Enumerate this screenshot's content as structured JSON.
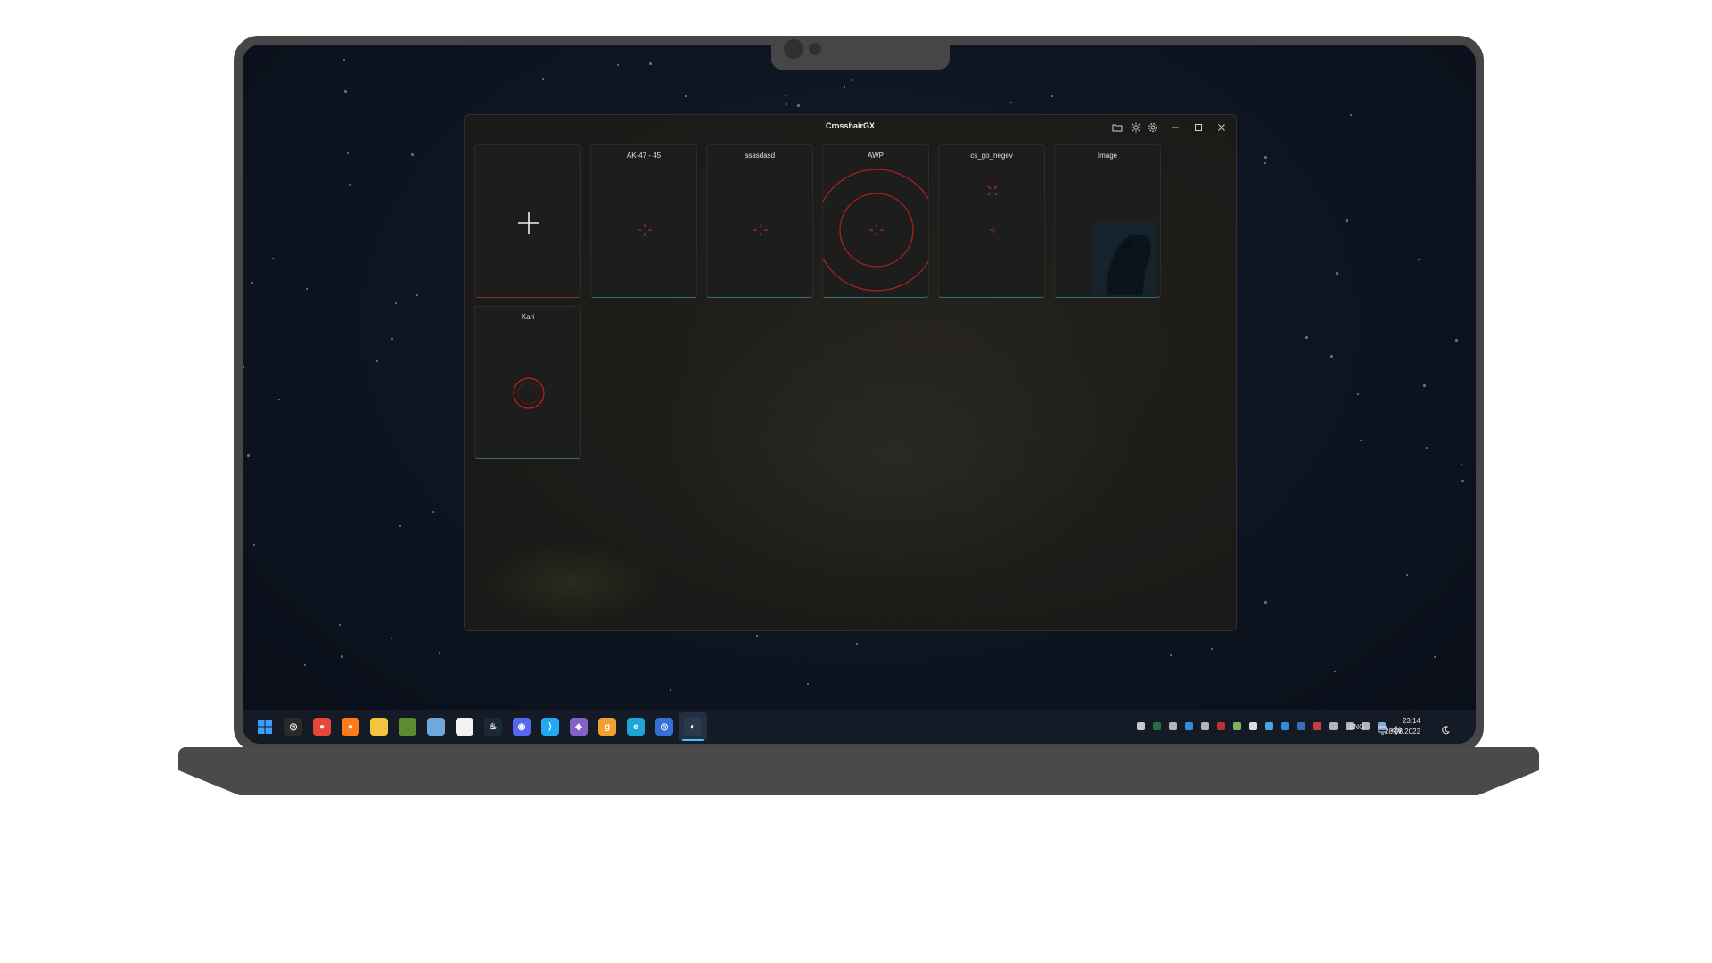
{
  "window": {
    "title": "CrosshairGX",
    "controls": [
      "folder-icon",
      "sun-icon",
      "gear-icon",
      "minimize-icon",
      "maximize-icon",
      "close-icon"
    ]
  },
  "cards": [
    {
      "name": "",
      "type": "add",
      "icon": "plus-icon"
    },
    {
      "name": "AK-47 - 45",
      "type": "cross-small"
    },
    {
      "name": "asasdasd",
      "type": "cross-small"
    },
    {
      "name": "AWP",
      "type": "circle-scope"
    },
    {
      "name": "cs_go_negev",
      "type": "x-and-cross"
    },
    {
      "name": "Image",
      "type": "image"
    },
    {
      "name": "Kari",
      "type": "circle-small"
    }
  ],
  "colors": {
    "crosshair": "#d12a2a",
    "accent_teal": "#37706d",
    "accent_red": "#8f2828",
    "taskbar_indicator": "#4cc2ff"
  },
  "taskbar": {
    "pinned": [
      "windows-start-icon",
      "obs-icon",
      "chrome-icon",
      "firefox-icon",
      "file-explorer-icon",
      "minecraft-icon",
      "photos-icon",
      "discord-alt-icon",
      "steam-icon",
      "discord-icon",
      "vscode-icon",
      "visual-studio-icon",
      "gog-icon",
      "edge-icon",
      "app-icon",
      "crosshairgx-icon"
    ],
    "lang": "ENG",
    "time": "23:14",
    "date": "28.08.2022"
  }
}
